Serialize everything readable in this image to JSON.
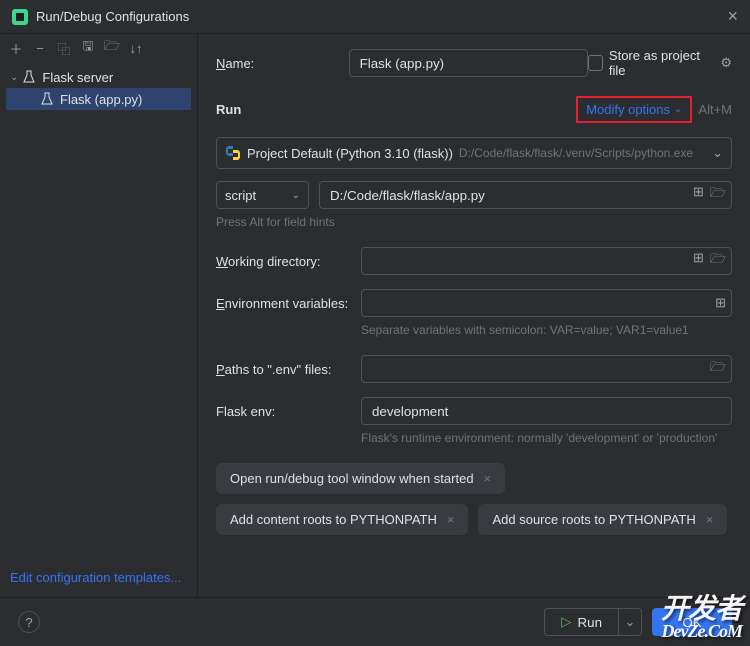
{
  "title": "Run/Debug Configurations",
  "tree": {
    "parent": "Flask server",
    "child": "Flask (app.py)"
  },
  "editTemplates": "Edit configuration templates...",
  "name": {
    "label": "Name:",
    "value": "Flask (app.py)"
  },
  "storeAsFile": "Store as project file",
  "run": {
    "title": "Run",
    "modifyOptions": "Modify options",
    "shortcut": "Alt+M",
    "interpreter": {
      "label": "Project Default (Python 3.10 (flask))",
      "path": "D:/Code/flask/flask/.venv/Scripts/python.exe"
    },
    "scriptMode": "script",
    "scriptPath": "D:/Code/flask/flask/app.py",
    "hint": "Press Alt for field hints",
    "workingDir": {
      "label": "Working directory:"
    },
    "envVars": {
      "label": "Environment variables:",
      "helper": "Separate variables with semicolon: VAR=value; VAR1=value1"
    },
    "envFiles": {
      "label": "Paths to \".env\" files:"
    },
    "flaskEnv": {
      "label": "Flask env:",
      "value": "development",
      "helper": "Flask's runtime environment: normally 'development' or 'production'"
    }
  },
  "chips": [
    "Open run/debug tool window when started",
    "Add content roots to PYTHONPATH",
    "Add source roots to PYTHONPATH"
  ],
  "footer": {
    "run": "Run",
    "ok": "OK"
  },
  "watermark": {
    "top": "开发者",
    "bottom": "DevZe.CoM"
  }
}
